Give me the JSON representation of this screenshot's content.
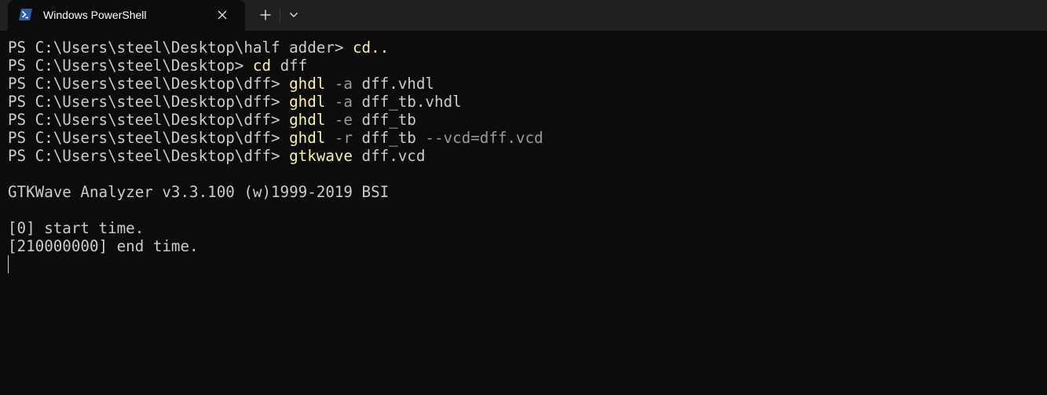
{
  "window": {
    "tab_title": "Windows PowerShell",
    "icons": {
      "tab": "powershell-icon",
      "close": "close-icon",
      "new_tab": "plus-icon",
      "dropdown": "chevron-down-icon"
    }
  },
  "colors": {
    "background": "#0c0c0c",
    "tabbar": "#202020",
    "foreground": "#cccccc",
    "command": "#f9f1a5",
    "parameter": "#9a9a9a",
    "powershell_icon": "#2b5da8"
  },
  "terminal": {
    "lines": [
      {
        "prompt": "PS C:\\Users\\steel\\Desktop\\half adder> ",
        "command": "cd..",
        "args": ""
      },
      {
        "prompt": "PS C:\\Users\\steel\\Desktop> ",
        "command": "cd",
        "args": " dff"
      },
      {
        "prompt": "PS C:\\Users\\steel\\Desktop\\dff> ",
        "command": "ghdl",
        "flag": " -a",
        "args": " dff.vhdl"
      },
      {
        "prompt": "PS C:\\Users\\steel\\Desktop\\dff> ",
        "command": "ghdl",
        "flag": " -a",
        "args": " dff_tb.vhdl"
      },
      {
        "prompt": "PS C:\\Users\\steel\\Desktop\\dff> ",
        "command": "ghdl",
        "flag": " -e",
        "args": " dff_tb"
      },
      {
        "prompt": "PS C:\\Users\\steel\\Desktop\\dff> ",
        "command": "ghdl",
        "flag": " -r",
        "args": " dff_tb",
        "flag2": " --vcd=dff.vcd"
      },
      {
        "prompt": "PS C:\\Users\\steel\\Desktop\\dff> ",
        "command": "gtkwave",
        "args": " dff.vcd"
      }
    ],
    "output": [
      "",
      "GTKWave Analyzer v3.3.100 (w)1999-2019 BSI",
      "",
      "[0] start time.",
      "[210000000] end time."
    ]
  }
}
